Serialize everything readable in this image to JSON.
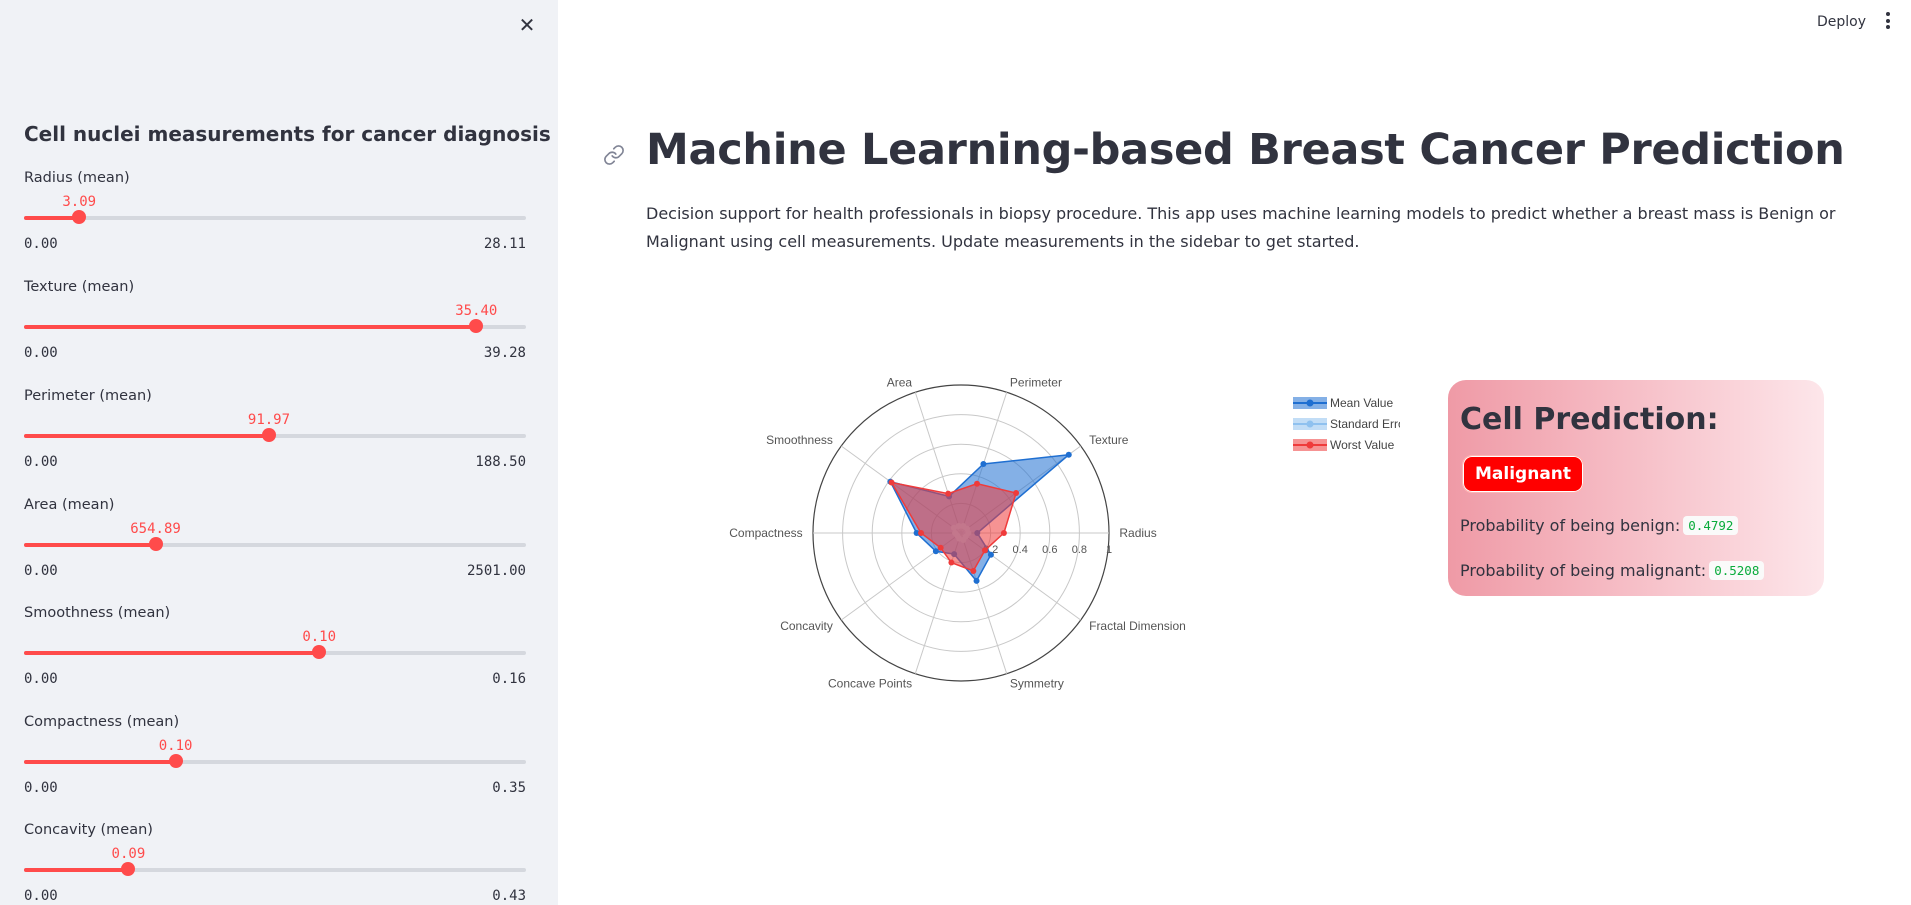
{
  "sidebar": {
    "title": "Cell nuclei measurements for cancer diagnosis",
    "close_icon": "close-icon",
    "sliders": [
      {
        "label": "Radius (mean)",
        "value": "3.09",
        "min": "0.00",
        "max": "28.11",
        "fraction": 0.11
      },
      {
        "label": "Texture (mean)",
        "value": "35.40",
        "min": "0.00",
        "max": "39.28",
        "fraction": 0.901
      },
      {
        "label": "Perimeter (mean)",
        "value": "91.97",
        "min": "0.00",
        "max": "188.50",
        "fraction": 0.488
      },
      {
        "label": "Area (mean)",
        "value": "654.89",
        "min": "0.00",
        "max": "2501.00",
        "fraction": 0.262
      },
      {
        "label": "Smoothness (mean)",
        "value": "0.10",
        "min": "0.00",
        "max": "0.16",
        "fraction": 0.588
      },
      {
        "label": "Compactness (mean)",
        "value": "0.10",
        "min": "0.00",
        "max": "0.35",
        "fraction": 0.302
      },
      {
        "label": "Concavity (mean)",
        "value": "0.09",
        "min": "0.00",
        "max": "0.43",
        "fraction": 0.208
      }
    ]
  },
  "header": {
    "deploy_label": "Deploy",
    "menu_icon": "more-vertical-icon"
  },
  "main": {
    "title": "Machine Learning-based Breast Cancer Prediction",
    "anchor_icon": "link-icon",
    "description": "Decision support for health professionals in biopsy procedure. This app uses machine learning models to predict whether a breast mass is Benign or Malignant using cell measurements. Update measurements in the sidebar to get started."
  },
  "prediction": {
    "title": "Cell Prediction:",
    "label": "Malignant",
    "benign_text": "Probability of being benign:",
    "benign_value": "0.4792",
    "malignant_text": "Probability of being malignant:",
    "malignant_value": "0.5208"
  },
  "colors": {
    "accent": "#ff4b4b",
    "mean": "#1f6fd1",
    "se": "#8fc1ef",
    "worst": "#ef3b3b",
    "malignant_badge": "#ff0000",
    "prob_value": "#09ab3b"
  },
  "chart_data": {
    "type": "radar",
    "categories": [
      "Radius",
      "Texture",
      "Perimeter",
      "Area",
      "Smoothness",
      "Compactness",
      "Concavity",
      "Concave Points",
      "Symmetry",
      "Fractal Dimension"
    ],
    "radial_ticks": [
      "0.2",
      "0.4",
      "0.6",
      "0.8",
      "1"
    ],
    "radial_range": [
      0,
      1
    ],
    "legend_position": "top-right",
    "series": [
      {
        "name": "Mean Value",
        "values": [
          0.11,
          0.9,
          0.49,
          0.26,
          0.59,
          0.3,
          0.21,
          0.15,
          0.34,
          0.25
        ]
      },
      {
        "name": "Standard Error",
        "values": [
          0.05,
          0.05,
          0.05,
          0.05,
          0.06,
          0.04,
          0.03,
          0.04,
          0.05,
          0.04
        ]
      },
      {
        "name": "Worst Value",
        "values": [
          0.29,
          0.46,
          0.35,
          0.28,
          0.58,
          0.27,
          0.17,
          0.21,
          0.27,
          0.2
        ]
      }
    ]
  }
}
